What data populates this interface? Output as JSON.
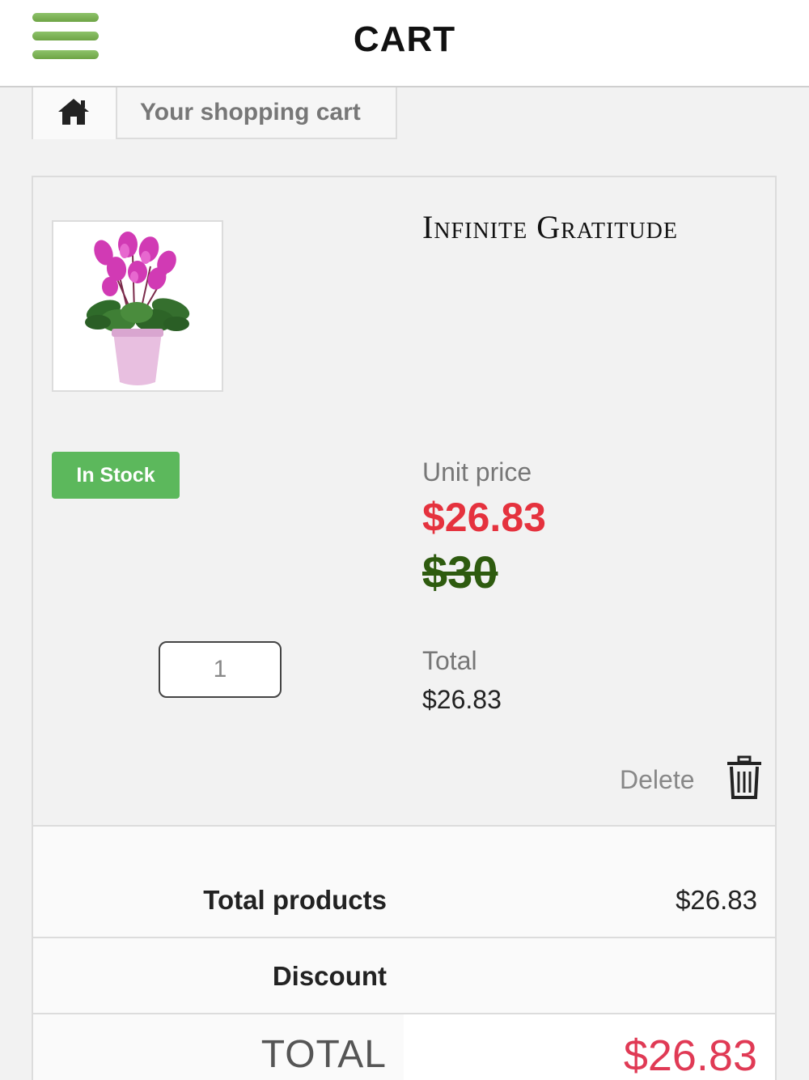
{
  "header": {
    "title": "CART",
    "menu_icon": "hamburger-menu-icon"
  },
  "breadcrumb": {
    "home_icon": "home-icon",
    "current": "Your shopping cart"
  },
  "item": {
    "name": "Infinite Gratitude",
    "image": "pink-cyclamen-flower-pot",
    "stock_status": "In Stock",
    "unit_price_label": "Unit price",
    "unit_price": "$26.83",
    "original_price": "$30",
    "quantity": "1",
    "total_label": "Total",
    "total_value": "$26.83",
    "delete_label": "Delete",
    "delete_icon": "trash-icon"
  },
  "summary": {
    "products_label": "Total products",
    "products_value": "$26.83",
    "discount_label": "Discount",
    "grand_label": "TOTAL",
    "grand_value": "$26.83"
  },
  "colors": {
    "accent_green": "#6ea445",
    "stock_green": "#5cb85c",
    "sale_red": "#e5323e",
    "old_price_green": "#2e5b0f",
    "total_pink": "#e03a55"
  }
}
